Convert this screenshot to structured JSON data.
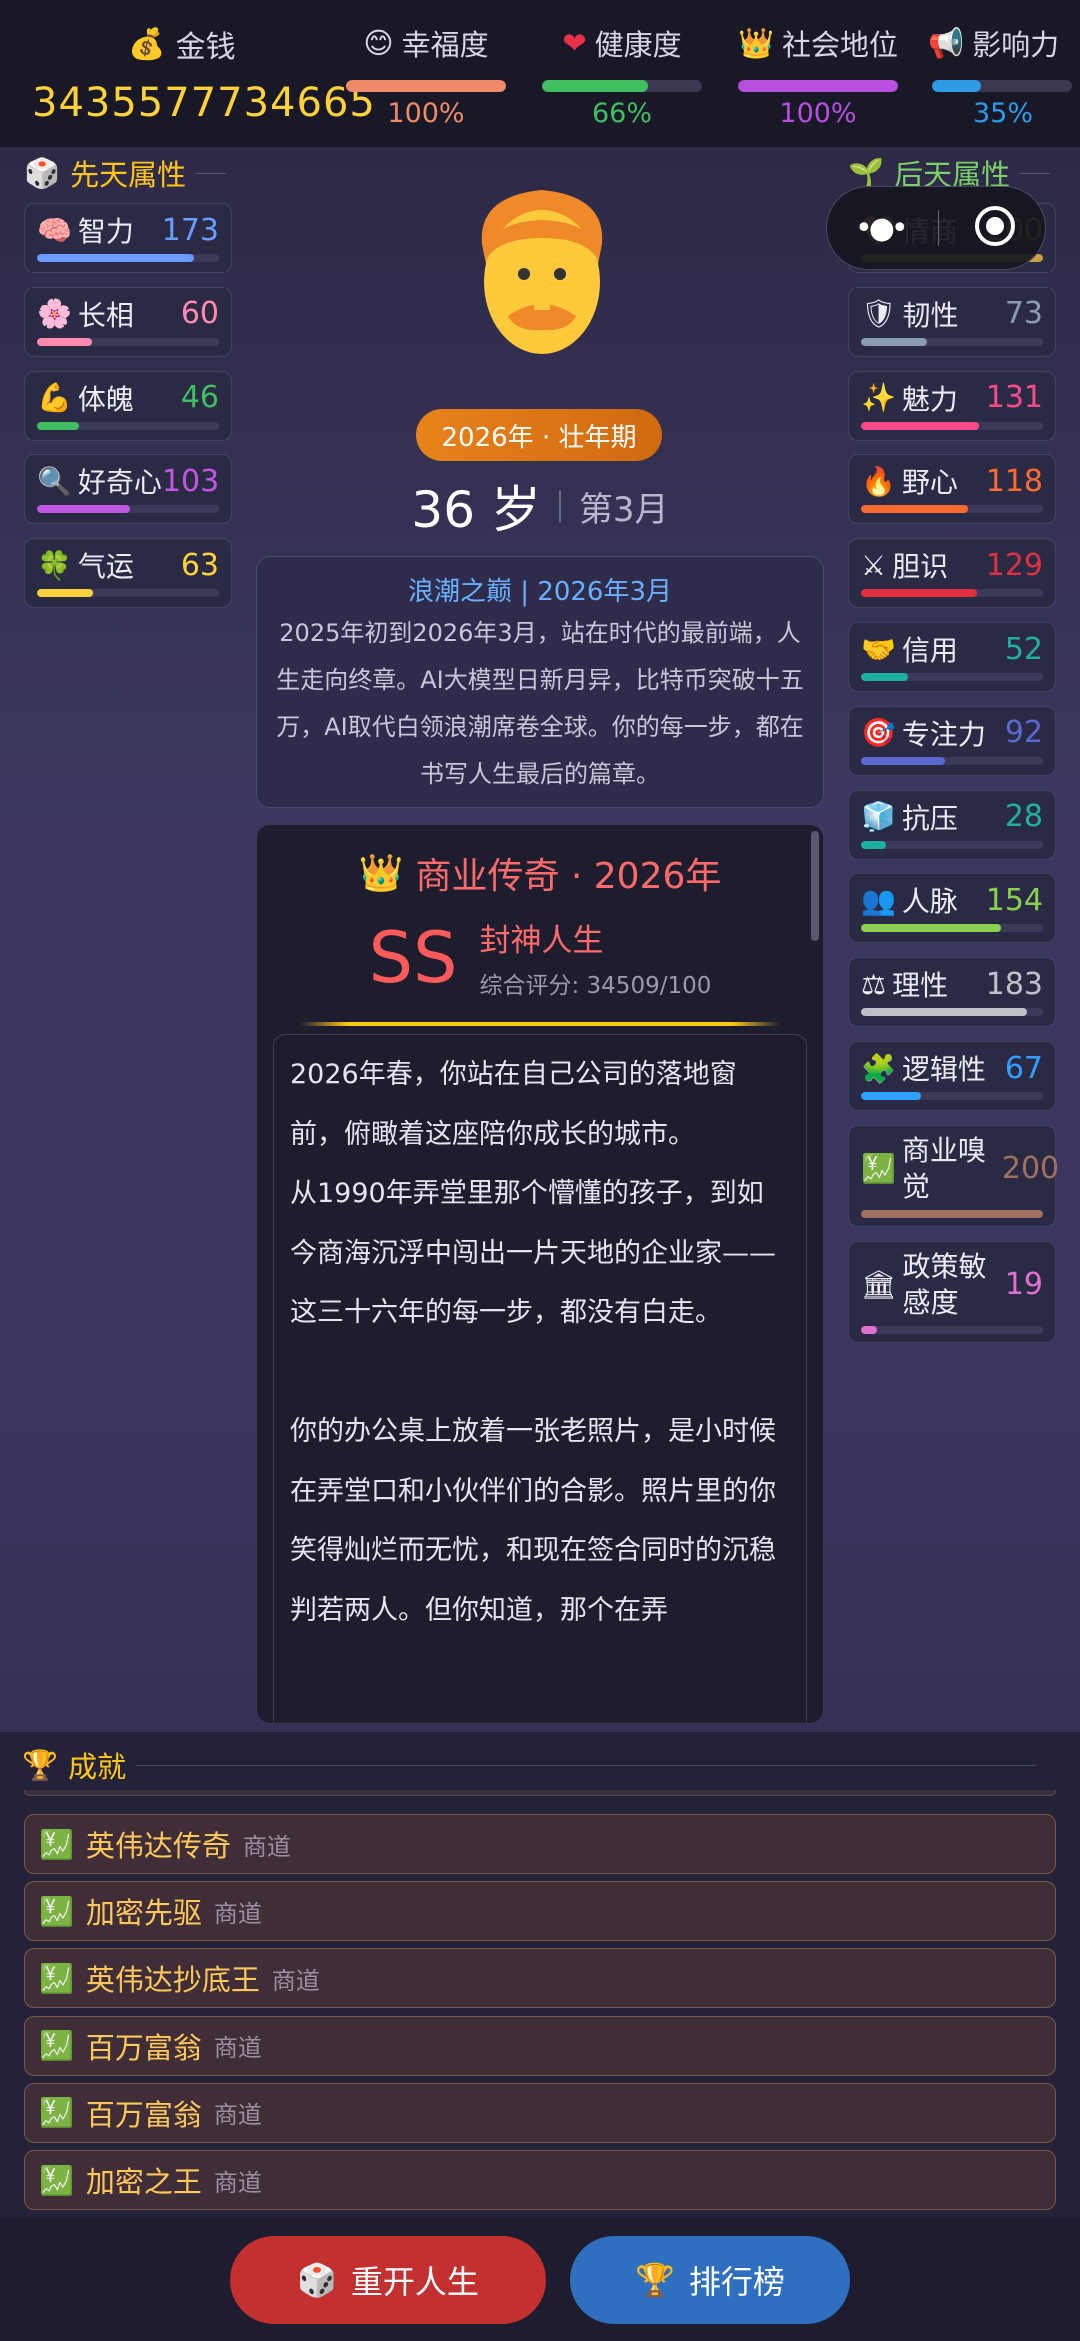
{
  "stats": {
    "money": {
      "label": "金钱",
      "value": "3435577734665",
      "color": "#ffd23a"
    },
    "happiness": {
      "label": "幸福度",
      "value": "100%",
      "fill": 1.0,
      "color": "#f08a6a"
    },
    "health": {
      "label": "健康度",
      "value": "66%",
      "fill": 0.66,
      "color": "#3fbf5f"
    },
    "status": {
      "label": "社会地位",
      "value": "100%",
      "fill": 1.0,
      "color": "#b94fe0"
    },
    "influence": {
      "label": "影响力",
      "value": "35%",
      "fill": 0.35,
      "color": "#2e9be8"
    }
  },
  "innate": {
    "title": "先天属性",
    "items": [
      {
        "name": "智力",
        "value": "173",
        "fill": 0.86,
        "color": "#6a9bff"
      },
      {
        "name": "长相",
        "value": "60",
        "fill": 0.3,
        "color": "#ff8ab0"
      },
      {
        "name": "体魄",
        "value": "46",
        "fill": 0.23,
        "color": "#3fbf5f"
      },
      {
        "name": "好奇心",
        "value": "103",
        "fill": 0.51,
        "color": "#c057e0"
      },
      {
        "name": "气运",
        "value": "63",
        "fill": 0.31,
        "color": "#ffd23a"
      }
    ]
  },
  "acquired": {
    "title": "后天属性",
    "items": [
      {
        "name": "情商",
        "value": "200",
        "fill": 1.0,
        "color": "#c8a040"
      },
      {
        "name": "韧性",
        "value": "73",
        "fill": 0.36,
        "color": "#8a9ab0"
      },
      {
        "name": "魅力",
        "value": "131",
        "fill": 0.65,
        "color": "#ff4a8a"
      },
      {
        "name": "野心",
        "value": "118",
        "fill": 0.59,
        "color": "#ff6a30"
      },
      {
        "name": "胆识",
        "value": "129",
        "fill": 0.64,
        "color": "#e03040"
      },
      {
        "name": "信用",
        "value": "52",
        "fill": 0.26,
        "color": "#20b0a0"
      },
      {
        "name": "专注力",
        "value": "92",
        "fill": 0.46,
        "color": "#5a6ad0"
      },
      {
        "name": "抗压",
        "value": "28",
        "fill": 0.14,
        "color": "#20b0a0"
      },
      {
        "name": "人脉",
        "value": "154",
        "fill": 0.77,
        "color": "#8ad050"
      },
      {
        "name": "理性",
        "value": "183",
        "fill": 0.91,
        "color": "#c0c0c8"
      },
      {
        "name": "逻辑性",
        "value": "67",
        "fill": 0.33,
        "color": "#30a0ff"
      },
      {
        "name": "商业嗅觉",
        "value": "200",
        "fill": 1.0,
        "color": "#a07060"
      },
      {
        "name": "政策敏感度",
        "value": "19",
        "fill": 0.09,
        "color": "#e070d0"
      }
    ]
  },
  "life": {
    "era": "2026年 · 壮年期",
    "age": "36 岁",
    "month": "第3月"
  },
  "event": {
    "title": "浪潮之巅 | 2026年3月",
    "body": "2025年初到2026年3月，站在时代的最前端，人生走向终章。AI大模型日新月异，比特币突破十五万，AI取代白领浪潮席卷全球。你的每一步，都在书写人生最后的篇章。"
  },
  "ending": {
    "title": "商业传奇 · 2026年",
    "grade": "SS",
    "grade_title": "封神人生",
    "score": "综合评分: 34509/100",
    "paragraphs": [
      "2026年春，你站在自己公司的落地窗前，俯瞰着这座陪你成长的城市。",
      "从1990年弄堂里那个懵懂的孩子，到如今商海沉浮中闯出一片天地的企业家——这三十六年的每一步，都没有白走。",
      "",
      "你的办公桌上放着一张老照片，是小时候在弄堂口和小伙伴们的合影。照片里的你笑得灿烂而无忧，和现在签合同时的沉稳判若两人。但你知道，那个在弄"
    ]
  },
  "achievements": {
    "title": "成就",
    "items": [
      {
        "name": "英伟达传奇",
        "category": "商道"
      },
      {
        "name": "加密先驱",
        "category": "商道"
      },
      {
        "name": "英伟达抄底王",
        "category": "商道"
      },
      {
        "name": "百万富翁",
        "category": "商道"
      },
      {
        "name": "百万富翁",
        "category": "商道"
      },
      {
        "name": "加密之王",
        "category": "商道"
      }
    ]
  },
  "buttons": {
    "restart": "重开人生",
    "leaderboard": "排行榜"
  }
}
